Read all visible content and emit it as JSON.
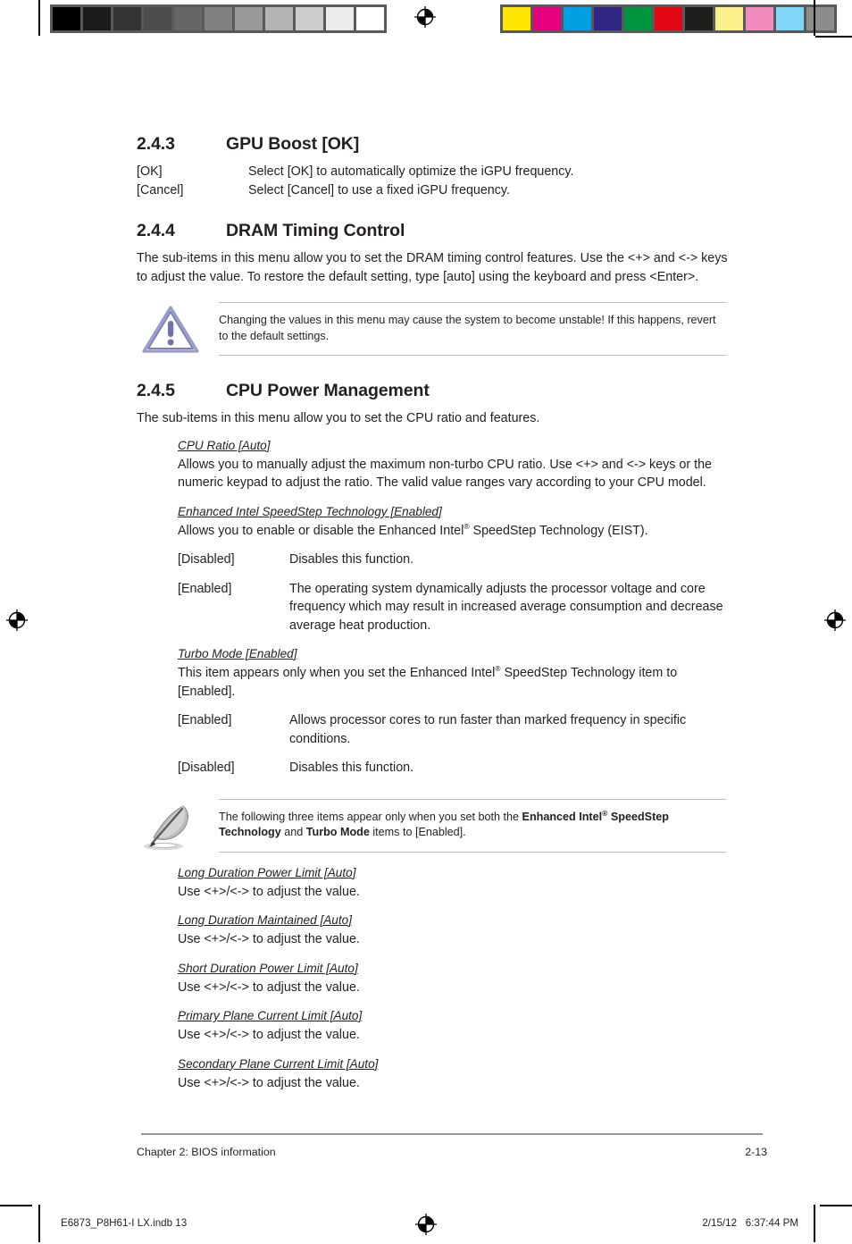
{
  "production": {
    "gray_bar_swatches": [
      "#000000",
      "#1b1b1b",
      "#333333",
      "#4d4d4d",
      "#666666",
      "#808080",
      "#999999",
      "#b3b3b3",
      "#cccccc",
      "#ececec",
      "#ffffff"
    ],
    "color_bar_swatches": [
      "#ffe600",
      "#e6007e",
      "#00a0e3",
      "#312783",
      "#009640",
      "#e30613",
      "#1d1d1b",
      "#fbf08b",
      "#f28cbe",
      "#80d6f7",
      "#8c8c8c"
    ],
    "filename": "E6873_P8H61-I LX.indb   13",
    "timestamp": "2/15/12   6:37:44 PM",
    "registration_icon": "registration-target-icon"
  },
  "sections": {
    "gpu_boost": {
      "number": "2.4.3",
      "title": "GPU Boost [OK]",
      "options": [
        {
          "key": "[OK]",
          "desc": "Select [OK] to automatically optimize the iGPU frequency."
        },
        {
          "key": "[Cancel]",
          "desc": "Select [Cancel] to use a fixed iGPU frequency."
        }
      ]
    },
    "dram_timing": {
      "number": "2.4.4",
      "title": "DRAM Timing Control",
      "intro": "The sub-items in this menu allow you to set the DRAM timing control features. Use the <+> and <-> keys to adjust the value. To restore the default setting, type [auto] using the keyboard and press <Enter>.",
      "warning": {
        "icon": "warning-triangle-icon",
        "text": "Changing the values in this menu may cause the system to become unstable! If this happens, revert to the default settings."
      }
    },
    "cpu_power": {
      "number": "2.4.5",
      "title": "CPU Power Management",
      "intro": "The sub-items in this menu allow you to set the CPU ratio and features.",
      "cpu_ratio": {
        "heading": "CPU Ratio [Auto]",
        "body": "Allows you to manually adjust the maximum non-turbo CPU ratio. Use <+> and <-> keys or the numeric keypad to adjust the ratio. The valid value ranges vary according to your CPU model."
      },
      "eist": {
        "heading": "Enhanced Intel SpeedStep Technology [Enabled]",
        "body_pre": "Allows you to enable or disable the Enhanced Intel",
        "body_sup": "®",
        "body_post": " SpeedStep Technology (EIST).",
        "options": [
          {
            "key": "[Disabled]",
            "desc": "Disables this function."
          },
          {
            "key": "[Enabled]",
            "desc": "The operating system dynamically adjusts the processor voltage and core frequency which may result in increased average consumption and decrease average heat production."
          }
        ]
      },
      "turbo_mode": {
        "heading": "Turbo Mode [Enabled]",
        "body_pre": "This item appears only when you set the Enhanced Intel",
        "body_sup": "®",
        "body_post": " SpeedStep Technology item to [Enabled].",
        "options": [
          {
            "key": "[Enabled]",
            "desc": "Allows processor cores to run faster than marked frequency in specific conditions."
          },
          {
            "key": "[Disabled]",
            "desc": "Disables this function."
          }
        ]
      },
      "note": {
        "icon": "quill-pen-icon",
        "text_pre": "The following three items appear only when you set both the ",
        "bold_1": "Enhanced Intel",
        "bold_1_sup": "®",
        "bold_1_cont": " SpeedStep Technology",
        "text_mid": " and ",
        "bold_2": "Turbo Mode",
        "text_post": " items to [Enabled]."
      },
      "limit_items": [
        {
          "heading": "Long Duration Power Limit [Auto]",
          "body": "Use <+>/<-> to adjust the value."
        },
        {
          "heading": "Long Duration Maintained [Auto]",
          "body": "Use <+>/<-> to adjust the value."
        },
        {
          "heading": "Short Duration Power Limit [Auto]",
          "body": "Use <+>/<-> to adjust the value."
        },
        {
          "heading": "Primary Plane Current Limit [Auto]",
          "body": "Use <+>/<-> to adjust the value."
        },
        {
          "heading": "Secondary Plane Current Limit [Auto]",
          "body": "Use <+>/<-> to adjust the value."
        }
      ]
    }
  },
  "footer": {
    "chapter": "Chapter 2: BIOS information",
    "page_number": "2-13"
  }
}
